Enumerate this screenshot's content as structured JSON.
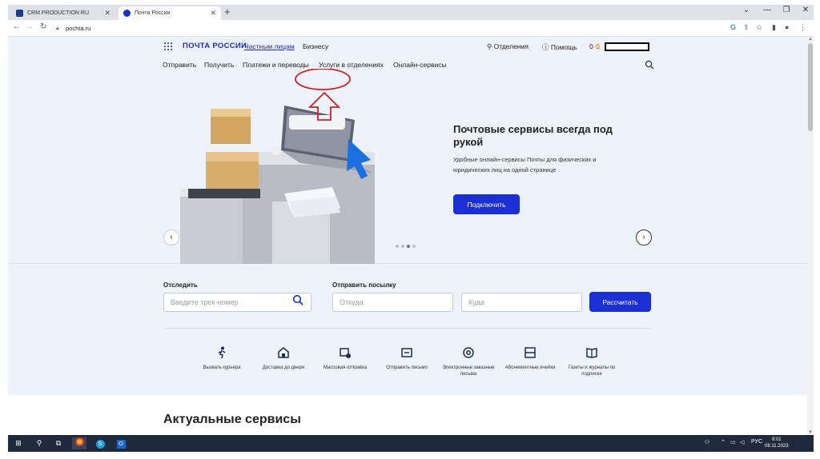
{
  "browser": {
    "tabs": [
      {
        "title": "CRM PRODUCTION RU"
      },
      {
        "title": "Почта России"
      }
    ],
    "new_tab": "+",
    "url": "pochta.ru"
  },
  "site": {
    "logo": "ПОЧТА РОССИИ",
    "segments": [
      "Частным лицам",
      "Бизнесу"
    ],
    "top_right": {
      "offices": "Отделения",
      "help": "Помощь",
      "balance": "0"
    },
    "main_nav": [
      "Отправить",
      "Получить",
      "Платежи и переводы",
      "Услуги в отделениях",
      "Онлайн-сервисы"
    ]
  },
  "hero": {
    "title": "Почтовые сервисы всегда под рукой",
    "description": "Удобные онлайн-сервисы Почты для физических и юридических лиц на одной странице",
    "button": "Подключить"
  },
  "tracking": {
    "track_label": "Отследить",
    "track_placeholder": "Введите трек-номер",
    "send_label": "Отправить посылку",
    "from_placeholder": "Откуда",
    "to_placeholder": "Куда",
    "calc_button": "Рассчитать"
  },
  "services": [
    {
      "label": "Вызвать курьера",
      "icon": "courier-icon"
    },
    {
      "label": "Доставка до двери",
      "icon": "home-icon"
    },
    {
      "label": "Массовая отправка",
      "icon": "bulk-icon"
    },
    {
      "label": "Отправить письмо",
      "icon": "letter-icon"
    },
    {
      "label": "Электронные заказные письма",
      "icon": "at-icon"
    },
    {
      "label": "Абонементные ячейки",
      "icon": "box-icon"
    },
    {
      "label": "Газеты и журналы по подписке",
      "icon": "book-icon"
    }
  ],
  "section_title": "Актуальные сервисы",
  "taskbar": {
    "lang": "РУС",
    "time": "9:01",
    "date": "08.11.2023"
  },
  "colors": {
    "brand": "#1b2fd6",
    "annotation": "#d62020"
  }
}
